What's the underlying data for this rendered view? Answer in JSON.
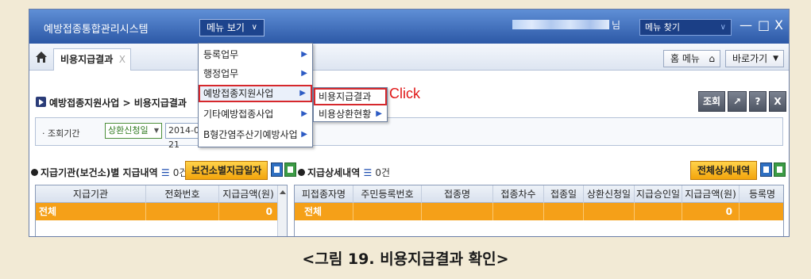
{
  "titlebar": {
    "app_title": "예방접종통합관리시스템",
    "menu_view": "메뉴 보기",
    "user_suffix": "님",
    "menu_search_placeholder": "메뉴 찾기",
    "min": "—",
    "max": "□",
    "close": "X"
  },
  "tabbar": {
    "active_tab": "비용지급결과",
    "tab_close": "X",
    "home_menu": "홈 메뉴",
    "goto": "바로가기"
  },
  "dropdown": {
    "items": [
      {
        "label": "등록업무",
        "arrow": "▶"
      },
      {
        "label": "행정업무",
        "arrow": "▶"
      },
      {
        "label": "예방접종지원사업",
        "arrow": "▶"
      },
      {
        "label": "기타예방접종사업",
        "arrow": "▶"
      },
      {
        "label": "B형간염주산기예방사업",
        "arrow": "▶"
      }
    ],
    "submenu": [
      {
        "label": "비용지급결과",
        "arrow": ""
      },
      {
        "label": "비용상환현황",
        "arrow": "▶"
      }
    ],
    "annotation": "Click"
  },
  "page": {
    "breadcrumb": "예방접종지원사업 > 비용지급결과",
    "buttons": {
      "search": "조회",
      "export": "↗",
      "help": "?",
      "close": "X"
    }
  },
  "search": {
    "label": "· 조회기간",
    "select_value": "상환신청일",
    "date_value": "2014-09-21"
  },
  "left_grid": {
    "title": "지급기관(보건소)별 지급내역",
    "list_icon": "☰",
    "count": "0건",
    "button": "보건소별지급일자",
    "columns": [
      "지급기관",
      "전화번호",
      "지급금액(원)"
    ],
    "row": [
      "전체",
      "",
      "0"
    ]
  },
  "right_grid": {
    "title": "지급상세내역",
    "list_icon": "☰",
    "count": "0건",
    "button": "전체상세내역",
    "columns": [
      "피접종자명",
      "주민등록번호",
      "접종명",
      "접종차수",
      "접종일",
      "상환신청일",
      "지급승인일",
      "지급금액(원)",
      "등록명"
    ],
    "row": [
      "전체",
      "",
      "",
      "",
      "",
      "",
      "",
      "0",
      ""
    ]
  },
  "caption": "<그림 19. 비용지급결과 확인>"
}
